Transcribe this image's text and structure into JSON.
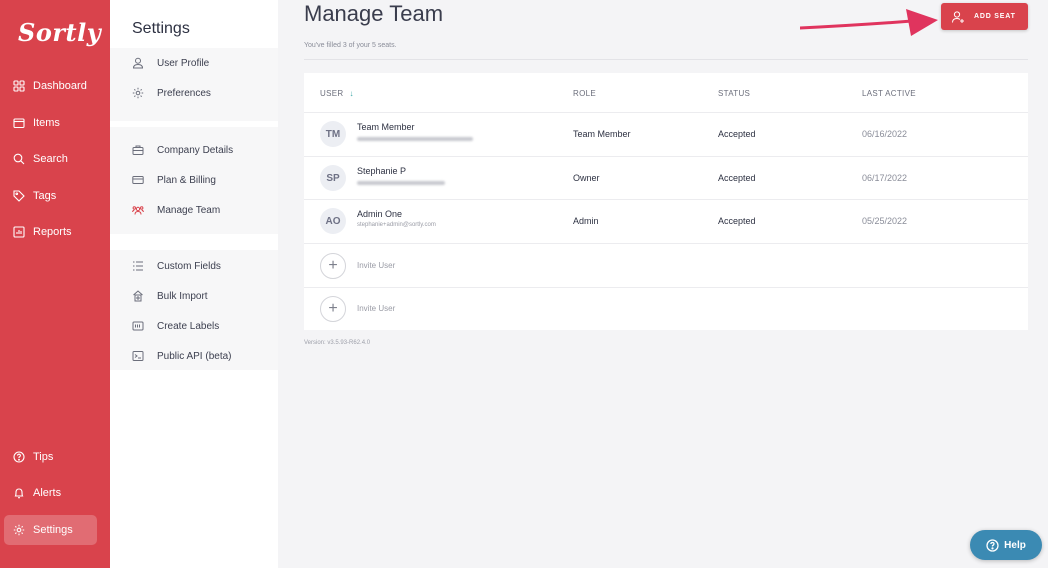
{
  "app": {
    "logo_text": "Sortly",
    "brand_color": "#d9434c",
    "accent_color": "#3aa6a6"
  },
  "nav": {
    "items": [
      {
        "label": "Dashboard",
        "icon": "dashboard-icon"
      },
      {
        "label": "Items",
        "icon": "folder-icon"
      },
      {
        "label": "Search",
        "icon": "search-icon"
      },
      {
        "label": "Tags",
        "icon": "tag-icon"
      },
      {
        "label": "Reports",
        "icon": "reports-icon"
      }
    ],
    "bottom_items": [
      {
        "label": "Tips",
        "icon": "question-circle-icon"
      },
      {
        "label": "Alerts",
        "icon": "bell-icon"
      },
      {
        "label": "Settings",
        "icon": "gear-icon",
        "active": true
      }
    ]
  },
  "settings": {
    "title": "Settings",
    "groups": [
      [
        {
          "label": "User Profile",
          "icon": "user-icon"
        },
        {
          "label": "Preferences",
          "icon": "gear-icon"
        }
      ],
      [
        {
          "label": "Company Details",
          "icon": "briefcase-icon"
        },
        {
          "label": "Plan & Billing",
          "icon": "credit-card-icon"
        },
        {
          "label": "Manage Team",
          "icon": "team-icon",
          "active": true
        }
      ],
      [
        {
          "label": "Custom Fields",
          "icon": "list-icon"
        },
        {
          "label": "Bulk Import",
          "icon": "import-icon"
        },
        {
          "label": "Create Labels",
          "icon": "label-icon"
        },
        {
          "label": "Public API (beta)",
          "icon": "terminal-icon"
        }
      ]
    ]
  },
  "main": {
    "title": "Manage Team",
    "subtitle": "You've filled 3 of your 5 seats.",
    "add_seat_label": "ADD SEAT",
    "columns": [
      "USER",
      "ROLE",
      "STATUS",
      "LAST ACTIVE"
    ],
    "rows": [
      {
        "initials": "TM",
        "name": "Team Member",
        "email": "",
        "role": "Team Member",
        "status": "Accepted",
        "last_active": "06/16/2022"
      },
      {
        "initials": "SP",
        "name": "Stephanie P",
        "email": "",
        "role": "Owner",
        "status": "Accepted",
        "last_active": "06/17/2022"
      },
      {
        "initials": "AO",
        "name": "Admin One",
        "email": "stephanie+admin@sortly.com",
        "role": "Admin",
        "status": "Accepted",
        "last_active": "05/25/2022"
      }
    ],
    "invites": [
      {
        "label": "Invite User"
      },
      {
        "label": "Invite User"
      }
    ],
    "version": "Version: v3.5.93-R62.4.0"
  },
  "help": {
    "label": "Help"
  }
}
